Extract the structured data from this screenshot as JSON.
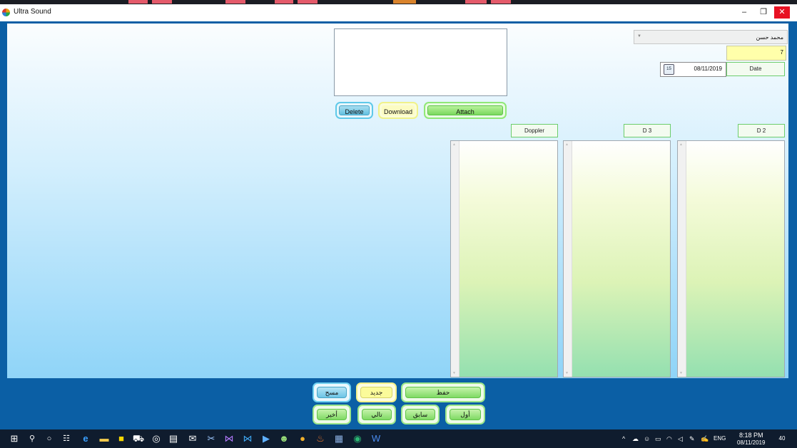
{
  "window": {
    "title": "Ultra Sound",
    "minimize": "–",
    "restore": "❐",
    "close": "✕"
  },
  "form": {
    "patient_name": "محمد حسن",
    "patient_id": "7",
    "date_value": "08/11/2019",
    "date_label": "Date",
    "calendar_day": "15"
  },
  "attachments": {
    "delete_label": "Delete",
    "download_label": "Download",
    "attach_label": "Attach"
  },
  "sections": {
    "doppler_label": "Doppler",
    "d3_label": "D 3",
    "d2_label": "D 2"
  },
  "actions": {
    "clear_label": "مسح",
    "new_label": "جديد",
    "save_label": "حفظ",
    "last_label": "أخير",
    "next_label": "تالي",
    "prev_label": "سابق",
    "first_label": "أول"
  },
  "taskbar": {
    "language": "ENG",
    "time": "8:18 PM",
    "date": "08/11/2019",
    "notifications": "40"
  },
  "colors": {
    "window_frame": "#0b5fa5",
    "close_button": "#e81123",
    "accent_green": "#7ad95d",
    "accent_cyan": "#62c0e0",
    "accent_yellow": "#fbfb9a"
  }
}
